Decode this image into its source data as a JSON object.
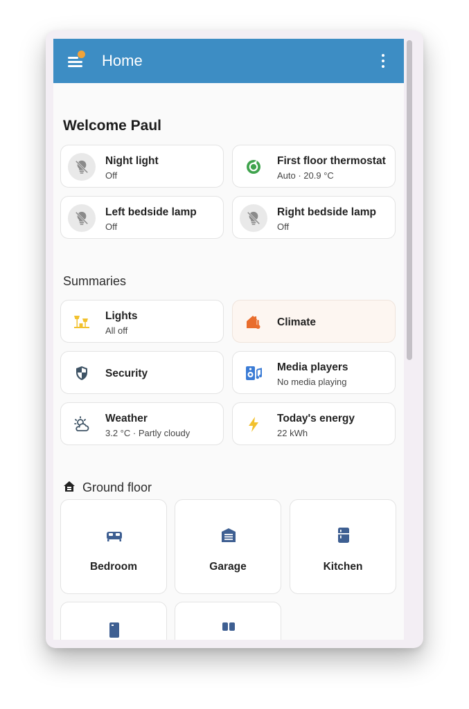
{
  "header": {
    "title": "Home"
  },
  "welcome": {
    "title": "Welcome Paul"
  },
  "quick_tiles": [
    {
      "name": "Night light",
      "state": "Off"
    },
    {
      "name": "First floor thermostat",
      "state": "Auto · 20.9 °C"
    },
    {
      "name": "Left bedside lamp",
      "state": "Off"
    },
    {
      "name": "Right bedside lamp",
      "state": "Off"
    }
  ],
  "summaries": {
    "title": "Summaries",
    "items": [
      {
        "name": "Lights",
        "state": "All off"
      },
      {
        "name": "Climate",
        "state": ""
      },
      {
        "name": "Security",
        "state": ""
      },
      {
        "name": "Media players",
        "state": "No media playing"
      },
      {
        "name": "Weather",
        "state": "3.2 °C · Partly cloudy"
      },
      {
        "name": "Today's energy",
        "state": "22 kWh"
      }
    ]
  },
  "ground_floor": {
    "title": "Ground floor",
    "areas": [
      {
        "name": "Bedroom"
      },
      {
        "name": "Garage"
      },
      {
        "name": "Kitchen"
      }
    ]
  },
  "colors": {
    "appbar": "#3d8dc4",
    "badge": "#f1a33a",
    "thermostat_green": "#3fa34d",
    "lights_yellow": "#f2c12e",
    "climate_orange": "#e96d2d",
    "media_blue": "#3a7bd5",
    "area_icon_blue": "#3e5f92"
  },
  "icons": {
    "menu": "menu-icon",
    "more": "dots-vertical-icon",
    "light_off": "lightbulb-off-icon",
    "thermostat": "thermostat-auto-icon",
    "lights": "floor-lamp-icon",
    "climate": "home-thermometer-icon",
    "security": "shield-icon",
    "media": "speaker-music-icon",
    "weather": "weather-partly-cloudy-icon",
    "energy": "lightning-bolt-icon",
    "floor": "home-floor-icon",
    "bedroom": "bed-icon",
    "garage": "garage-icon",
    "kitchen": "fridge-icon"
  }
}
